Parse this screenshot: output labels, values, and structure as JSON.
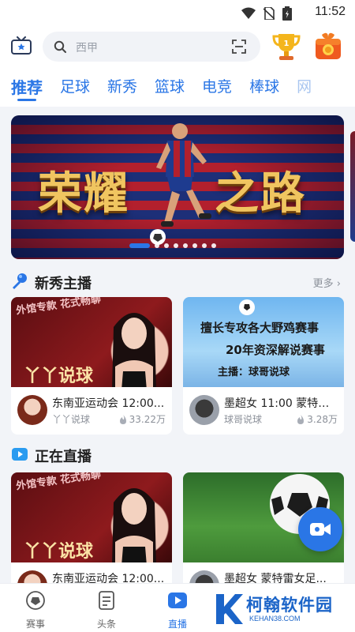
{
  "status_bar": {
    "time": "11:52"
  },
  "search": {
    "placeholder": "西甲"
  },
  "tabs": [
    "推荐",
    "足球",
    "新秀",
    "篮球",
    "电竞",
    "棒球",
    "网"
  ],
  "banner": {
    "title_left": "荣耀",
    "title_right": "之路",
    "dot_count": 8,
    "active_dot": 0
  },
  "section_rookie": {
    "title": "新秀主播",
    "more_label": "更多",
    "cards": [
      {
        "title": "东南亚运动会 12:00...",
        "name": "丫丫说球",
        "hot": "33.22万",
        "thumb_text_top": "外馆专款 花式畅聊",
        "thumb_text_bottom": "丫丫说球"
      },
      {
        "title": "墨超女 11:00 蒙特雷...",
        "name": "球哥说球",
        "hot": "3.28万",
        "thumb_line1": "擅长专攻各大野鸡赛事",
        "thumb_line2": "20年资深解说赛事",
        "thumb_line3": "主播：球哥说球"
      }
    ]
  },
  "section_live": {
    "title": "正在直播",
    "cards": [
      {
        "title": "东南亚运动会 12:00...",
        "thumb_text_top": "外馆专款 花式畅聊",
        "thumb_text_bottom": "丫丫说球"
      },
      {
        "title": "墨超女 蒙特雷女足..."
      }
    ]
  },
  "bottom_nav": [
    {
      "label": "赛事",
      "icon": "soccer-ball-icon"
    },
    {
      "label": "头条",
      "icon": "document-icon"
    },
    {
      "label": "直播",
      "icon": "play-icon"
    }
  ],
  "watermark": {
    "text": "柯翰软件园",
    "url_text": "KEHAN38.COM"
  },
  "colors": {
    "accent": "#2a76e6",
    "background": "#f2f4f8"
  }
}
